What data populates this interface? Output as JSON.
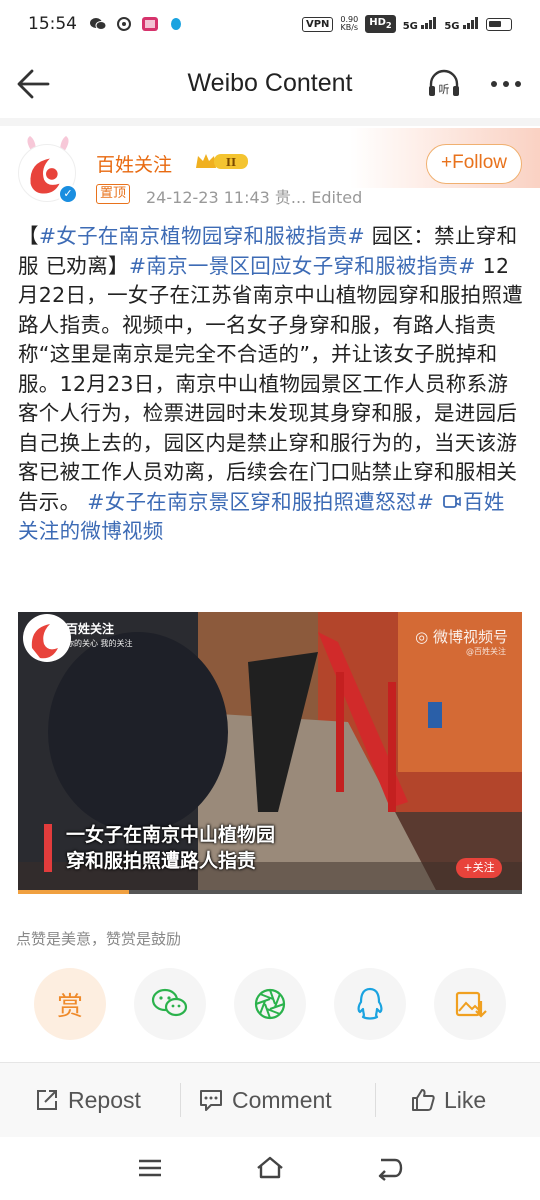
{
  "status_bar": {
    "time": "15:54",
    "vpn": "VPN",
    "speed_value": "0.90",
    "speed_unit": "KB/s",
    "hd": "HD",
    "hd_sub": "2",
    "net1": "5G",
    "net2": "5G"
  },
  "header": {
    "title": "Weibo Content",
    "listen_label": "听"
  },
  "post": {
    "username": "百姓关注",
    "vip_level": "II",
    "pin_label": "置顶",
    "meta": "24-12-23 11:43  贵...   Edited",
    "follow_label": "+Follow",
    "body": {
      "open_bracket": "【",
      "topic1": "#女子在南京植物园穿和服被指责#",
      "text1": " 园区：禁止穿和服 已劝离】",
      "topic2": "#南京一景区回应女子穿和服被指责#",
      "text2": " 12月22日，一女子在江苏省南京中山植物园穿和服拍照遭路人指责。视频中，一名女子身穿和服，有路人指责称“这里是南京是完全不合适的”，并让该女子脱掉和服。12月23日，南京中山植物园景区工作人员称系游客个人行为，检票进园时未发现其身穿和服，是进园后自己换上去的，园区内是禁止穿和服行为的，当天该游客已被工作人员劝离，后续会在门口贴禁止穿和服相关告示。",
      "topic3": "#女子在南京景区穿和服拍照遭怒怼#",
      "video_link": "百姓关注的微博视频"
    }
  },
  "video": {
    "logo_name": "百姓关注",
    "logo_sub": "你的关心 我的关注",
    "watermark": "微博视频号",
    "watermark_sub": "@百姓关注",
    "caption_line1": "一女子在南京中山植物园",
    "caption_line2": "穿和服拍照遭路人指责",
    "follow_label": "+关注",
    "progress": 0.22
  },
  "reward": {
    "hint": "点赞是美意，赞赏是鼓励",
    "reward_label": "赏",
    "share_icons": [
      "wechat-icon",
      "moments-icon",
      "qq-icon",
      "save-image-icon"
    ]
  },
  "actions": {
    "repost": "Repost",
    "comment": "Comment",
    "like": "Like"
  },
  "colors": {
    "topic": "#3d6bb5",
    "accent": "#e8721c",
    "username": "#e86a10"
  }
}
